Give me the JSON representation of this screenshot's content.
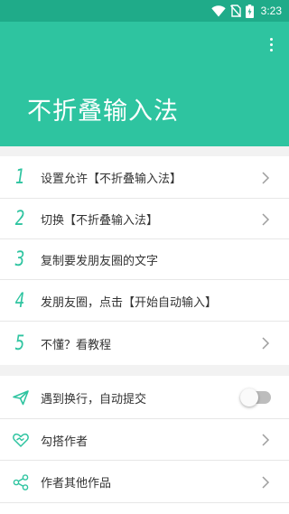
{
  "status_bar": {
    "time": "3:23",
    "icons": [
      "wifi-icon",
      "no-sim-icon",
      "battery-charging-icon"
    ]
  },
  "header": {
    "title": "不折叠输入法",
    "menu_icon": "more-vertical-icon"
  },
  "steps": [
    {
      "number": "1",
      "label": "设置允许【不折叠输入法】",
      "has_chevron": true
    },
    {
      "number": "2",
      "label": "切换【不折叠输入法】",
      "has_chevron": true
    },
    {
      "number": "3",
      "label": "复制要发朋友圈的文字",
      "has_chevron": false
    },
    {
      "number": "4",
      "label": "发朋友圈，点击【开始自动输入】",
      "has_chevron": false
    },
    {
      "number": "5",
      "label": "不懂？看教程",
      "has_chevron": true
    }
  ],
  "options": [
    {
      "icon": "send-icon",
      "label": "遇到换行，自动提交",
      "control": "toggle",
      "toggle_on": false
    },
    {
      "icon": "heart-handshake-icon",
      "label": "勾搭作者",
      "control": "chevron"
    },
    {
      "icon": "share-icon",
      "label": "作者其他作品",
      "control": "chevron"
    }
  ],
  "colors": {
    "status_bar": "#1fab89",
    "header": "#2ec4a0",
    "accent": "#2ec4a0",
    "background": "#f2f2f2"
  }
}
